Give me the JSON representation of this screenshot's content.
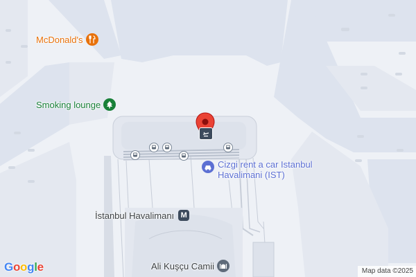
{
  "map": {
    "pois": {
      "mcdonalds": {
        "label": "McDonald's",
        "icon": "restaurant-icon",
        "color": "#e8710a"
      },
      "smoking_lounge": {
        "label": "Smoking lounge",
        "icon": "tree-icon",
        "color": "#188038"
      },
      "cizgi": {
        "label_line1": "Cizgi rent a car Istanbul",
        "label_line2": "Havalimani (IST)",
        "icon": "car-rental-icon",
        "color": "#5b6fd3"
      },
      "istanbul_havalimani": {
        "label": "İstanbul Havalimanı",
        "icon": "metro-icon",
        "color": "#3c4043"
      },
      "ali_kuscu": {
        "label": "Ali Kuşçu Camii",
        "icon": "mosque-icon",
        "color": "#3c4043"
      }
    },
    "bus_stops": [
      "bus-stop-icon",
      "bus-stop-icon",
      "bus-stop-icon",
      "bus-stop-icon",
      "bus-stop-icon"
    ],
    "pin": {
      "icon": "location-pin-icon",
      "inner_icon": "airport-icon",
      "color": "#ea4335"
    },
    "logo": {
      "letters": [
        "G",
        "o",
        "o",
        "g",
        "l",
        "e"
      ],
      "colors": [
        "#4285f4",
        "#ea4335",
        "#fbbc05",
        "#4285f4",
        "#34a853",
        "#ea4335"
      ]
    },
    "attribution": "Map data ©2025"
  }
}
